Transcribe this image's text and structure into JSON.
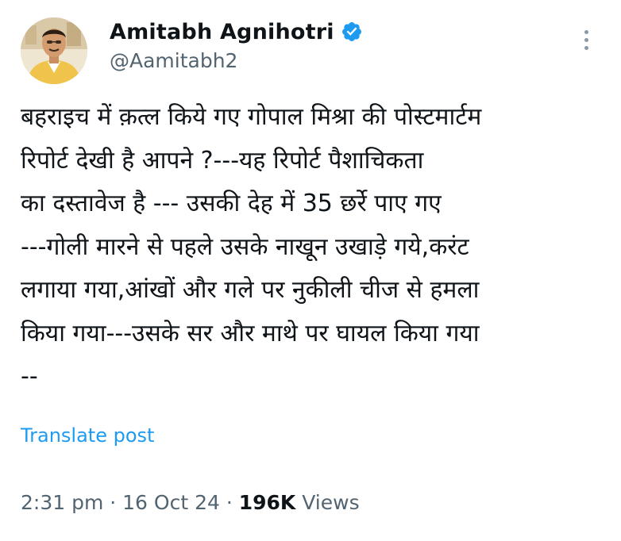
{
  "author": {
    "display_name": "Amitabh Agnihotri",
    "handle": "@Aamitabh2",
    "verified": true,
    "verified_badge_color": "#1d9bf0"
  },
  "icons": {
    "verified": "verified-badge-icon",
    "more": "more-vertical-icon"
  },
  "post": {
    "text": "बहराइच में क़त्ल किये गए गोपाल मिश्रा की पोस्टमार्टम\nरिपोर्ट देखी है आपने ?---यह रिपोर्ट पैशाचिकता\nका दस्तावेज है --- उसकी देह में 35 छर्रे पाए गए\n---गोली मारने से पहले उसके नाखून उखाड़े गये,करंट\nलगाया गया,आंखों और गले पर नुकीली चीज से हमला\nकिया गया---उसके सर और माथे पर घायल किया गया\n--",
    "translate_label": "Translate post"
  },
  "meta": {
    "time": "2:31 pm",
    "separator": " · ",
    "date": "16 Oct 24",
    "views_count": "196K",
    "views_label": " Views"
  },
  "colors": {
    "text_primary": "#0f1419",
    "text_secondary": "#536471",
    "link": "#1d9bf0"
  }
}
